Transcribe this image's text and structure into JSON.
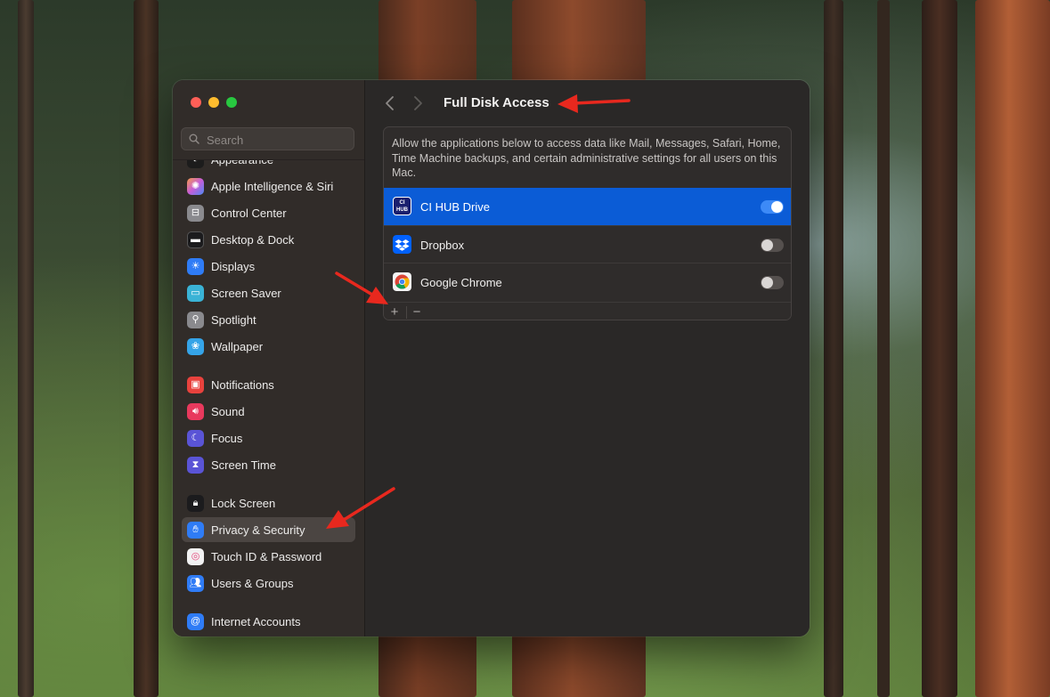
{
  "colors": {
    "accent": "#0b5cd6",
    "toggle_on": "#3d8af7",
    "annotation_arrow": "#e8281e"
  },
  "sidebar": {
    "search": {
      "placeholder": "Search",
      "icon": "search-icon"
    },
    "items": [
      {
        "label": "Appearance",
        "icon": "appearance-icon",
        "color": "#1c1c1c"
      },
      {
        "label": "Apple Intelligence & Siri",
        "icon": "siri-icon",
        "color": "#c65dd8"
      },
      {
        "label": "Control Center",
        "icon": "control-center-icon",
        "color": "#8a8a8e"
      },
      {
        "label": "Desktop & Dock",
        "icon": "dock-icon",
        "color": "#1b1b1d"
      },
      {
        "label": "Displays",
        "icon": "displays-icon",
        "color": "#2f7cf6"
      },
      {
        "label": "Screen Saver",
        "icon": "screen-saver-icon",
        "color": "#3ab3d6"
      },
      {
        "label": "Spotlight",
        "icon": "spotlight-icon",
        "color": "#8a8a8e"
      },
      {
        "label": "Wallpaper",
        "icon": "wallpaper-icon",
        "color": "#35a4e8"
      },
      {
        "label": "Notifications",
        "icon": "notifications-icon",
        "color": "#e8423d"
      },
      {
        "label": "Sound",
        "icon": "sound-icon",
        "color": "#e8395d"
      },
      {
        "label": "Focus",
        "icon": "focus-icon",
        "color": "#5a54d6"
      },
      {
        "label": "Screen Time",
        "icon": "screen-time-icon",
        "color": "#5a54d6"
      },
      {
        "label": "Lock Screen",
        "icon": "lock-icon",
        "color": "#1b1b1d"
      },
      {
        "label": "Privacy & Security",
        "icon": "hand-icon",
        "color": "#2f7cf6",
        "selected": true
      },
      {
        "label": "Touch ID & Password",
        "icon": "fingerprint-icon",
        "color": "#f2f2f2"
      },
      {
        "label": "Users & Groups",
        "icon": "users-icon",
        "color": "#2f7cf6"
      },
      {
        "label": "Internet Accounts",
        "icon": "at-icon",
        "color": "#2f7cf6"
      }
    ]
  },
  "main": {
    "title": "Full Disk Access",
    "description": "Allow the applications below to access data like Mail, Messages, Safari, Home, Time Machine backups, and certain administrative settings for all users on this Mac.",
    "apps": [
      {
        "name": "CI HUB Drive",
        "icon_text": "CI HUB",
        "enabled": true,
        "selected": true
      },
      {
        "name": "Dropbox",
        "icon": "dropbox-icon",
        "enabled": false,
        "selected": false
      },
      {
        "name": "Google Chrome",
        "icon": "chrome-icon",
        "enabled": false,
        "selected": false
      }
    ],
    "footer": {
      "add_label": "+",
      "remove_label": "−"
    }
  }
}
